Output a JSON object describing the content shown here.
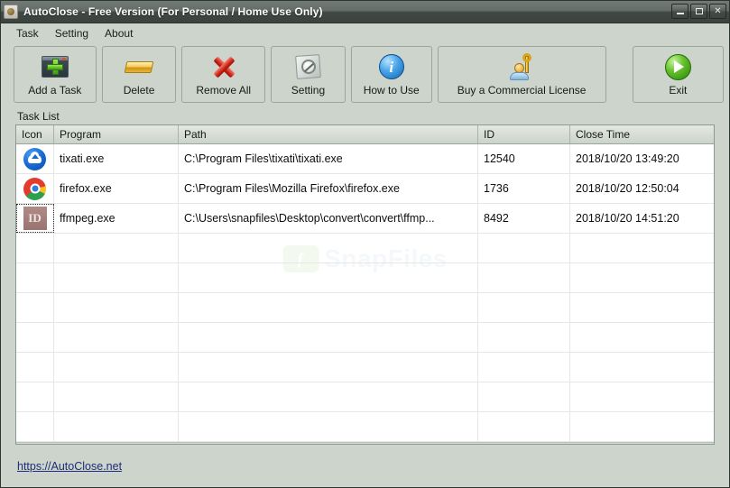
{
  "window": {
    "title": "AutoClose - Free Version (For Personal / Home Use Only)",
    "app_icon": "camera-icon",
    "controls": {
      "minimize": "minimize-icon",
      "maximize": "maximize-icon",
      "close": "✕"
    }
  },
  "menubar": {
    "items": [
      {
        "label": "Task"
      },
      {
        "label": "Setting"
      },
      {
        "label": "About"
      }
    ]
  },
  "toolbar": {
    "buttons": [
      {
        "label": "Add a Task",
        "icon": "window-plus-icon"
      },
      {
        "label": "Delete",
        "icon": "eraser-icon"
      },
      {
        "label": "Remove All",
        "icon": "red-x-icon"
      },
      {
        "label": "Setting",
        "icon": "gauge-icon"
      },
      {
        "label": "How to Use",
        "icon": "info-circle-icon"
      },
      {
        "label": "Buy a Commercial License",
        "icon": "key-person-icon"
      },
      {
        "label": "Exit",
        "icon": "green-arrow-icon"
      }
    ],
    "info_glyph": "i"
  },
  "list": {
    "label": "Task List",
    "columns": [
      {
        "key": "icon",
        "label": "Icon"
      },
      {
        "key": "program",
        "label": "Program"
      },
      {
        "key": "path",
        "label": "Path"
      },
      {
        "key": "id",
        "label": "ID"
      },
      {
        "key": "close_time",
        "label": "Close Time"
      }
    ],
    "rows": [
      {
        "icon": "tixati-icon",
        "program": "tixati.exe",
        "path": "C:\\Program Files\\tixati\\tixati.exe",
        "id": "12540",
        "close_time": "2018/10/20 13:49:20"
      },
      {
        "icon": "chrome-icon",
        "program": "firefox.exe",
        "path": "C:\\Program Files\\Mozilla Firefox\\firefox.exe",
        "id": "1736",
        "close_time": "2018/10/20 12:50:04"
      },
      {
        "icon": "id-icon",
        "icon_text": "ID",
        "program": "ffmpeg.exe",
        "path": "C:\\Users\\snapfiles\\Desktop\\convert\\convert\\ffmp...",
        "id": "8492",
        "close_time": "2018/10/20 14:51:20"
      }
    ],
    "empty_row_count": 7,
    "watermark": {
      "text": "SnapFiles",
      "logo_glyph": "ƒ"
    }
  },
  "scrollbar": {
    "left_arrow": "left-arrow-icon",
    "right_arrow": "right-arrow-icon"
  },
  "footer": {
    "link_text": "https://AutoClose.net"
  },
  "colors": {
    "window_background": "#ccd4cc",
    "titlebar_dark": "#3b433f",
    "link": "#1f2d7a",
    "accent_green": "#3f9b18",
    "accent_red": "#cf2418",
    "accent_blue": "#1565b0",
    "accent_gold": "#d8a51c"
  }
}
